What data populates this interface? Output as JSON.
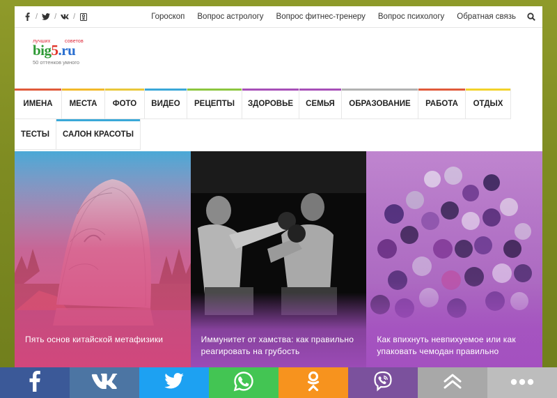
{
  "topbar": {
    "social_icons": [
      {
        "name": "facebook-icon",
        "glyph": "f"
      },
      {
        "name": "twitter-icon",
        "glyph": "t"
      },
      {
        "name": "vk-icon",
        "glyph": "vk"
      },
      {
        "name": "odnoklassniki-icon",
        "glyph": "ok"
      }
    ],
    "separator": "/",
    "links": [
      "Гороскоп",
      "Вопрос астрологу",
      "Вопрос фитнес-тренеру",
      "Вопрос психологу",
      "Обратная связь"
    ]
  },
  "logo": {
    "small_left": "лучших",
    "small_right": "советов",
    "big": "big",
    "num": "5",
    "domain": ".ru",
    "tagline": "50 оттенков умного"
  },
  "nav": {
    "row1": [
      {
        "label": "ИМЕНА",
        "color": "#e05a3a"
      },
      {
        "label": "МЕСТА",
        "color": "#f2b92a"
      },
      {
        "label": "ФОТО",
        "color": "#e9c73a"
      },
      {
        "label": "ВИДЕО",
        "color": "#3aa8d8"
      },
      {
        "label": "РЕЦЕПТЫ",
        "color": "#8cc63f"
      },
      {
        "label": "ЗДОРОВЬЕ",
        "color": "#a74fb8"
      },
      {
        "label": "СЕМЬЯ",
        "color": "#a74fb8"
      },
      {
        "label": "ОБРАЗОВАНИЕ",
        "color": "#b2b2b2"
      },
      {
        "label": "РАБОТА",
        "color": "#e05a3a"
      },
      {
        "label": "ОТДЫХ",
        "color": "#f2d22a"
      }
    ],
    "row2": [
      {
        "label": "ТЕСТЫ",
        "color": "#ffffff"
      },
      {
        "label": "САЛОН КРАСОТЫ",
        "color": "#3aa8d8"
      }
    ]
  },
  "cards": [
    {
      "title": "Пять основ китайской метафизики",
      "overlay": "#d9447a"
    },
    {
      "title": "Иммунитет от хамства: как правильно реагировать на грубость",
      "overlay": "#a44fc0"
    },
    {
      "title": "Как впихнуть невпихуемое или как упаковать чемодан правильно",
      "overlay": "#a44fc0"
    }
  ],
  "share_bar": [
    {
      "name": "facebook-share-icon",
      "color": "#3b5998"
    },
    {
      "name": "vk-share-icon",
      "color": "#4c75a3"
    },
    {
      "name": "twitter-share-icon",
      "color": "#1da1f2"
    },
    {
      "name": "whatsapp-share-icon",
      "color": "#43c553"
    },
    {
      "name": "odnoklassniki-share-icon",
      "color": "#f7931e"
    },
    {
      "name": "viber-share-icon",
      "color": "#7b519d"
    },
    {
      "name": "scroll-up-icon",
      "color": "#a8a8a8"
    },
    {
      "name": "more-icon",
      "color": "#bdbdbd"
    }
  ]
}
